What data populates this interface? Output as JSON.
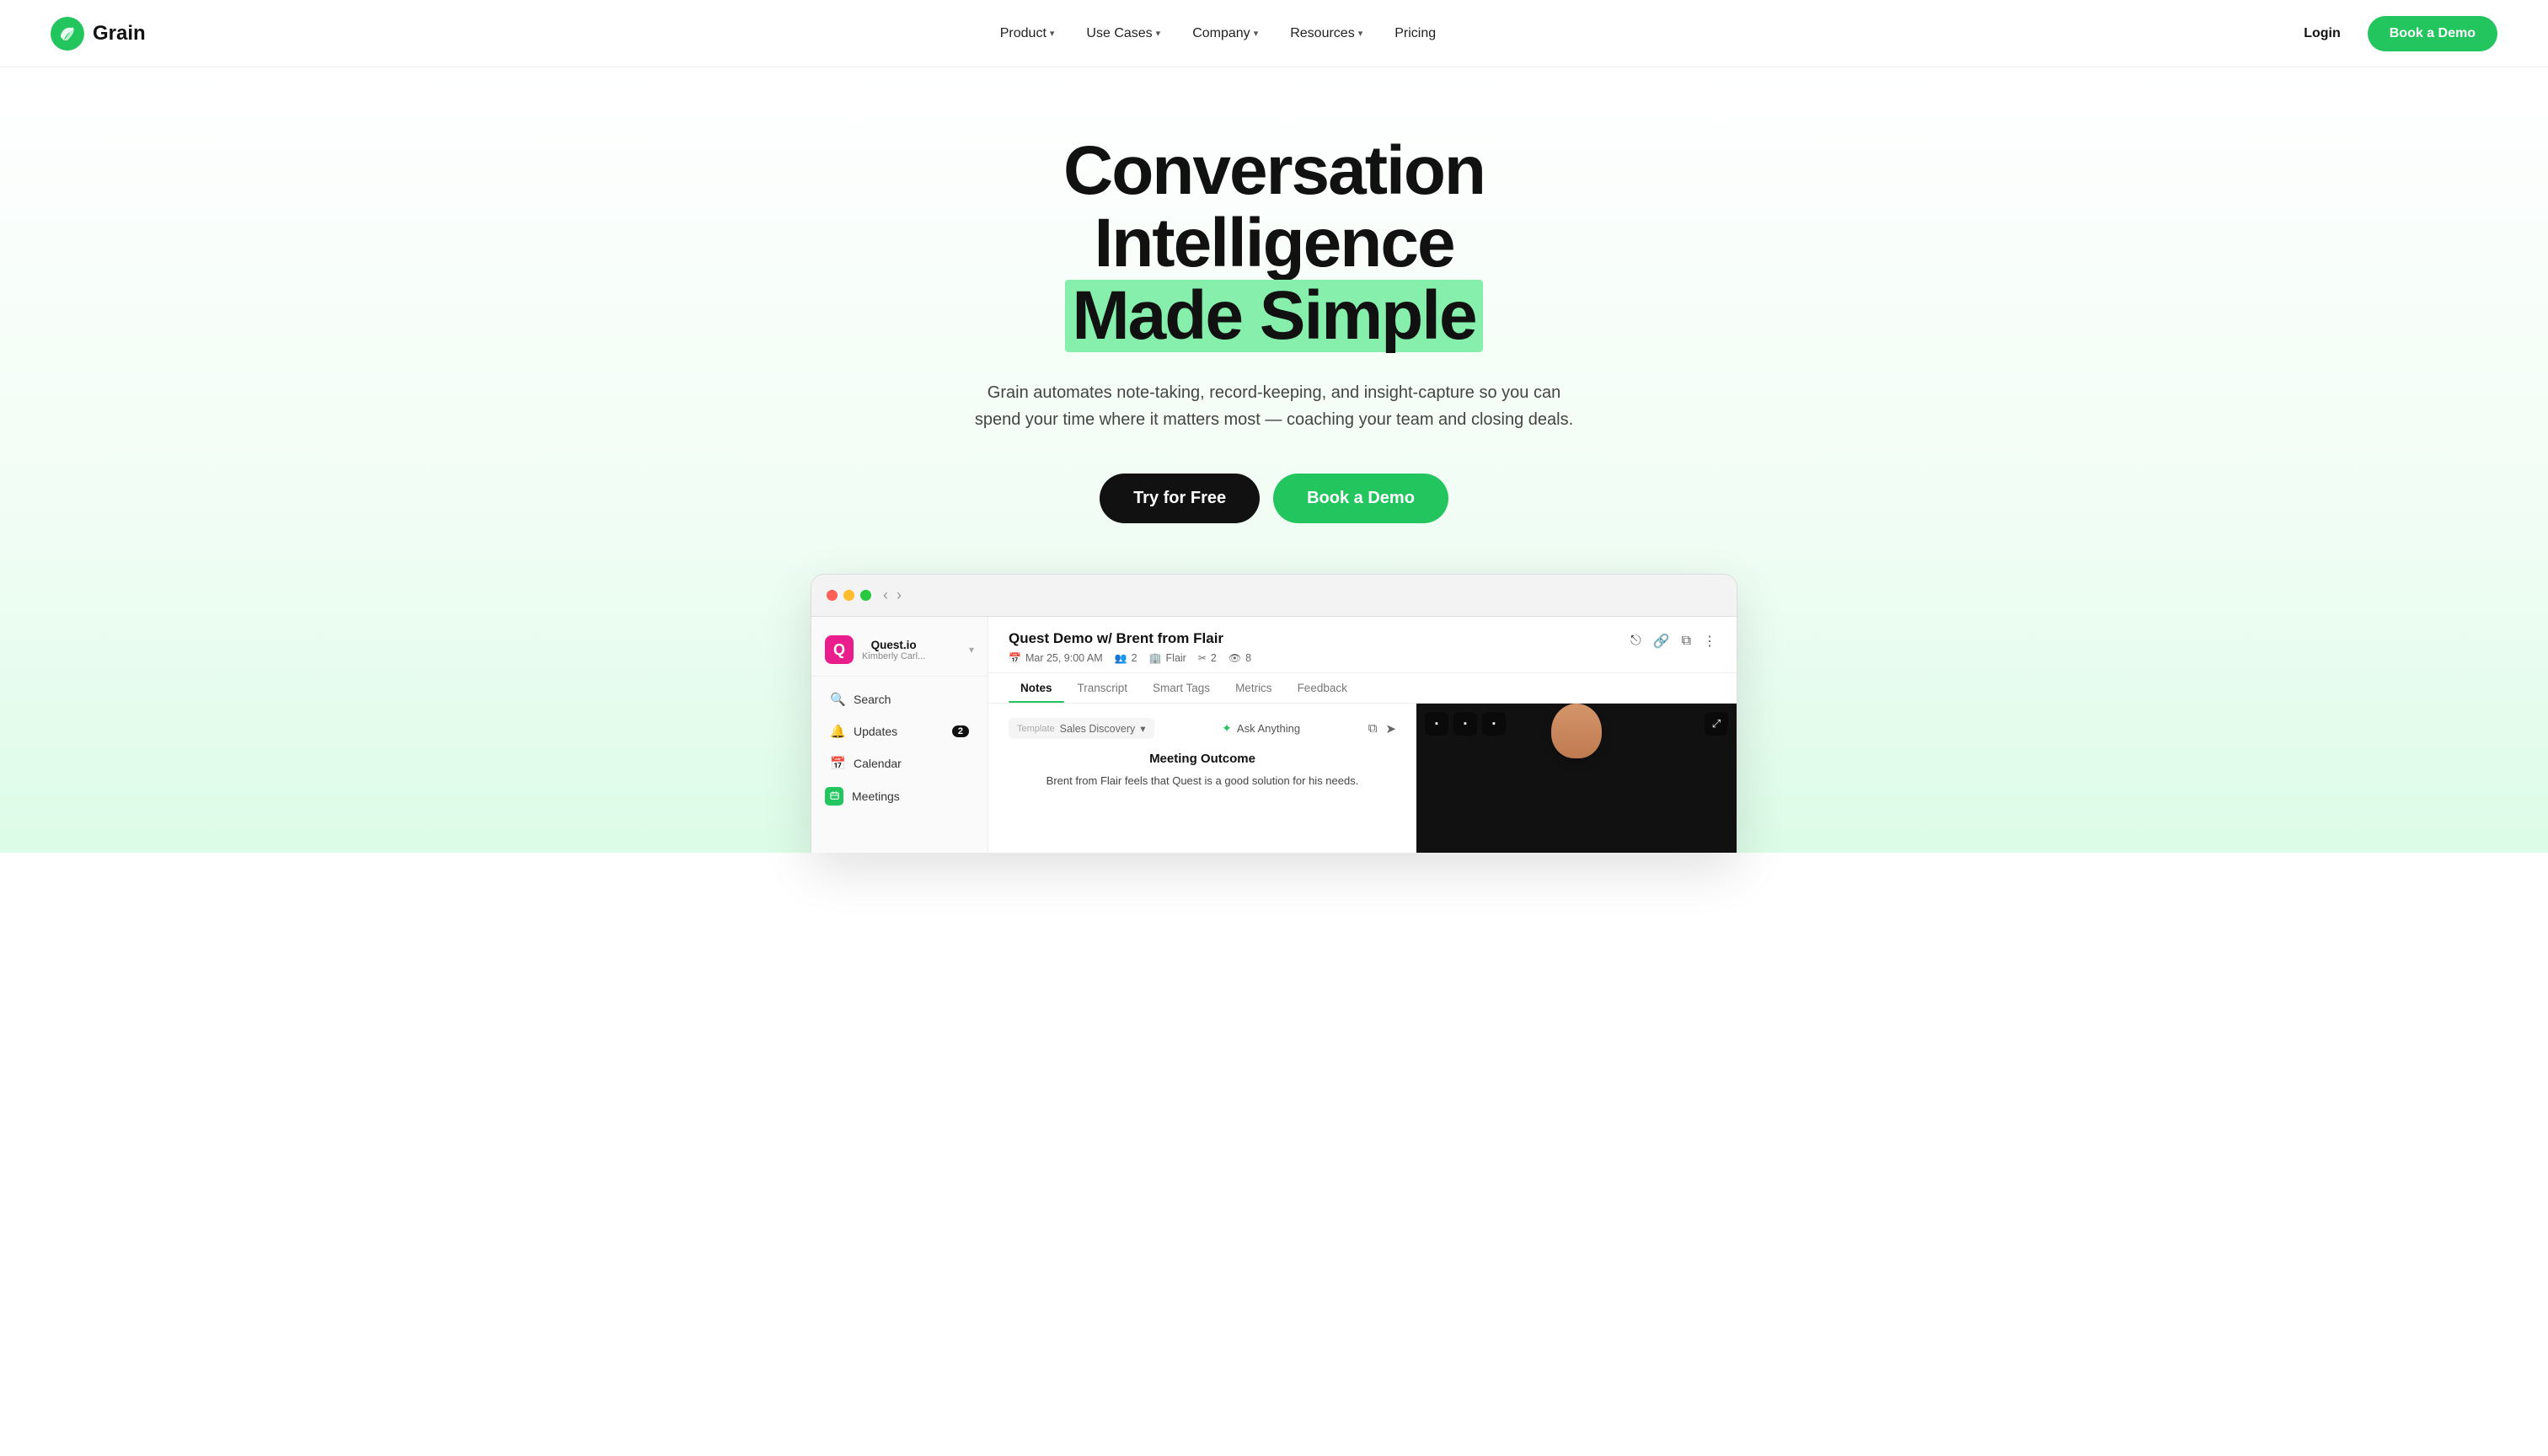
{
  "brand": {
    "name": "Grain",
    "logo_icon": "🌿"
  },
  "nav": {
    "links": [
      {
        "label": "Product",
        "hasDropdown": true
      },
      {
        "label": "Use Cases",
        "hasDropdown": true
      },
      {
        "label": "Company",
        "hasDropdown": true
      },
      {
        "label": "Resources",
        "hasDropdown": true
      },
      {
        "label": "Pricing",
        "hasDropdown": false
      }
    ],
    "login_label": "Login",
    "book_demo_label": "Book a Demo"
  },
  "hero": {
    "title_line1": "Conversation Intelligence",
    "title_line2": "Made Simple",
    "subtitle": "Grain automates note-taking, record-keeping, and insight-capture so you can spend your time where it matters most — coaching your team and closing deals.",
    "try_free_label": "Try for Free",
    "book_demo_label": "Book a Demo"
  },
  "app_demo": {
    "meeting_title": "Quest Demo w/ Brent from Flair",
    "meeting_date": "Mar 25, 9:00 AM",
    "meeting_attendees": "2",
    "meeting_company": "Flair",
    "meeting_clips": "2",
    "meeting_views": "8",
    "tabs": [
      "Notes",
      "Transcript",
      "Smart Tags",
      "Metrics",
      "Feedback"
    ],
    "active_tab": "Notes",
    "template_label": "Template",
    "template_name": "Sales Discovery",
    "ask_anything": "Ask Anything",
    "note_heading": "Meeting Outcome",
    "note_text": "Brent from Flair feels that Quest is a good solution for his needs.",
    "sidebar": {
      "org_name": "Quest.io",
      "org_user": "Kimberly Carl...",
      "items": [
        {
          "label": "Search",
          "icon": "🔍",
          "badge": null
        },
        {
          "label": "Updates",
          "icon": "🔔",
          "badge": "2"
        },
        {
          "label": "Calendar",
          "icon": "📅",
          "badge": null
        },
        {
          "label": "Meetings",
          "icon": "meetings",
          "badge": null
        }
      ]
    }
  }
}
